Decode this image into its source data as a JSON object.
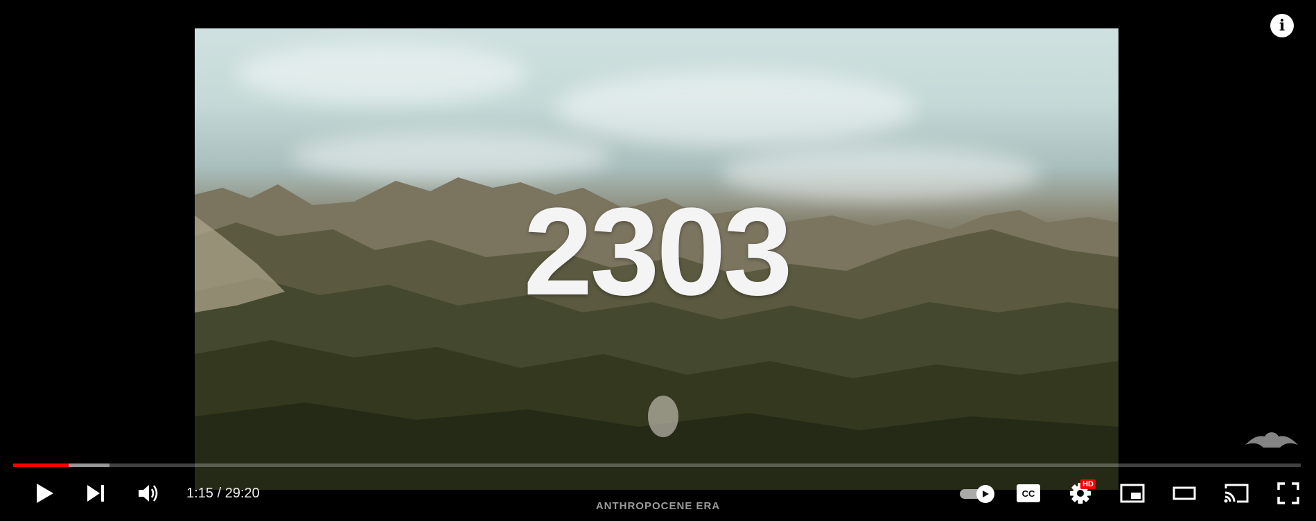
{
  "video": {
    "overlay_title": "2303",
    "chapter_title": "ANTHROPOCENE ERA"
  },
  "player": {
    "time_display": "1:15 / 29:20",
    "current_time": "1:15",
    "duration": "29:20",
    "progress_played_fraction": 0.043,
    "progress_buffered_fraction": 0.075,
    "hd_badge": "HD",
    "autoplay_on": true
  },
  "controls": {
    "left": [
      "play-icon",
      "next-icon",
      "volume-icon"
    ],
    "right": [
      "autoplay-toggle-icon",
      "captions-icon",
      "settings-icon",
      "miniplayer-icon",
      "theater-mode-icon",
      "cast-icon",
      "fullscreen-icon"
    ],
    "captions_label": "CC"
  },
  "info_button": {
    "label": "i"
  },
  "colors": {
    "progress_played": "#ff0000",
    "hd_badge": "#ff0000",
    "background": "#000000",
    "chapter_text": "#9b9b9b"
  }
}
